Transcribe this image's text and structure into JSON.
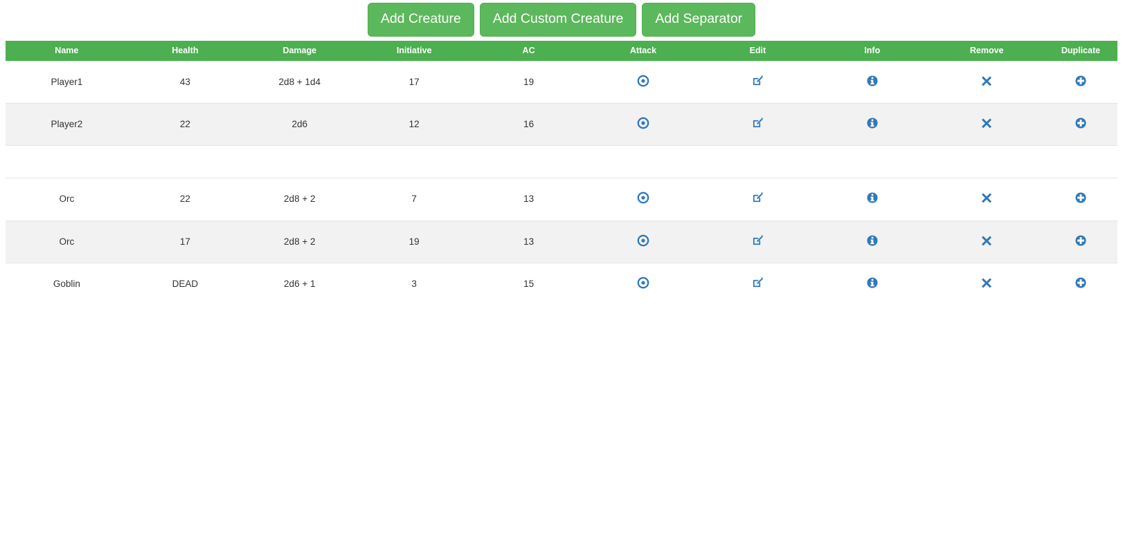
{
  "toolbar": {
    "buttons": [
      {
        "label": "Add Creature",
        "name": "add-creature-button"
      },
      {
        "label": "Add Custom Creature",
        "name": "add-custom-creature-button"
      },
      {
        "label": "Add Separator",
        "name": "add-separator-button"
      }
    ],
    "button_color": "#5cb85c"
  },
  "table": {
    "header_color": "#4caf50",
    "columns": [
      "Name",
      "Health",
      "Damage",
      "Initiative",
      "AC",
      "Attack",
      "Edit",
      "Info",
      "Remove",
      "Duplicate"
    ],
    "icons": {
      "attack": "target-icon",
      "edit": "edit-square-pencil-icon",
      "info": "info-circle-icon",
      "remove": "close-x-icon",
      "duplicate": "plus-circle-icon"
    },
    "colors": {
      "health_alive": "#1a7a1a",
      "health_dead": "#e8130d",
      "icon_blue": "#3079b8",
      "stripe": "#f2f2f2"
    },
    "rows": [
      {
        "type": "creature",
        "name": "Player1",
        "health": "43",
        "health_state": "alive",
        "damage": "2d8 + 1d4",
        "initiative": "17",
        "ac": "19"
      },
      {
        "type": "creature",
        "name": "Player2",
        "health": "22",
        "health_state": "alive",
        "damage": "2d6",
        "initiative": "12",
        "ac": "16"
      },
      {
        "type": "separator",
        "name": "",
        "health": "",
        "health_state": "",
        "damage": "",
        "initiative": "",
        "ac": ""
      },
      {
        "type": "creature",
        "name": "Orc",
        "health": "22",
        "health_state": "alive",
        "damage": "2d8 + 2",
        "initiative": "7",
        "ac": "13"
      },
      {
        "type": "creature",
        "name": "Orc",
        "health": "17",
        "health_state": "alive",
        "damage": "2d8 + 2",
        "initiative": "19",
        "ac": "13"
      },
      {
        "type": "creature",
        "name": "Goblin",
        "health": "DEAD",
        "health_state": "dead",
        "damage": "2d6 + 1",
        "initiative": "3",
        "ac": "15"
      }
    ]
  }
}
